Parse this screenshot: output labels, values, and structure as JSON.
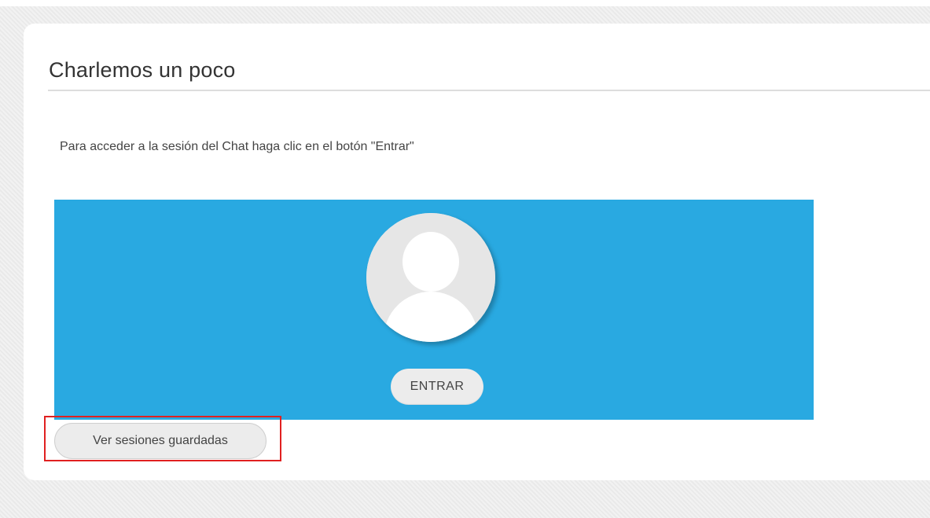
{
  "page": {
    "title": "Charlemos un poco",
    "instruction": "Para acceder a la sesión del Chat haga clic en el botón \"Entrar\""
  },
  "chat_panel": {
    "avatar_icon": "user-placeholder-icon",
    "enter_label": "ENTRAR",
    "background_color": "#29a9e1"
  },
  "sessions": {
    "saved_sessions_label": "Ver sesiones guardadas"
  },
  "annotation": {
    "highlight_color": "#e02020"
  }
}
